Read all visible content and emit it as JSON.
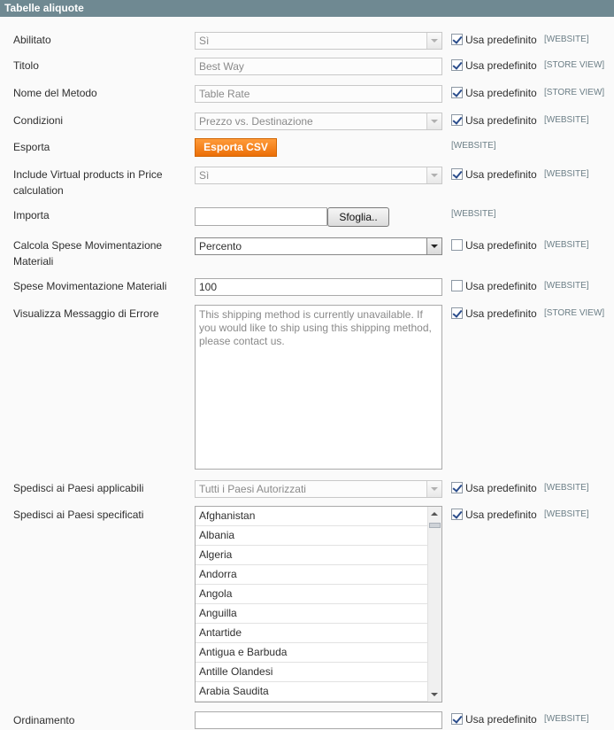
{
  "section": {
    "title": "Tabelle aliquote"
  },
  "defaults": {
    "use_default_label": "Usa predefinito"
  },
  "scopes": {
    "website": "[WEBSITE]",
    "store_view": "[STORE VIEW]"
  },
  "rows": {
    "abilitato": {
      "label": "Abilitato",
      "value": "Sì"
    },
    "titolo": {
      "label": "Titolo",
      "value": "Best Way"
    },
    "nome_metodo": {
      "label": "Nome del Metodo",
      "value": "Table Rate"
    },
    "condizioni": {
      "label": "Condizioni",
      "value": "Prezzo vs. Destinazione"
    },
    "esporta": {
      "label": "Esporta",
      "button": "Esporta CSV"
    },
    "virtual": {
      "label": "Include Virtual products in Price calculation",
      "value": "Sì"
    },
    "importa": {
      "label": "Importa",
      "button": "Sfoglia.."
    },
    "calcola": {
      "label": "Calcola Spese Movimentazione Materiali",
      "value": "Percento"
    },
    "spese": {
      "label": "Spese Movimentazione Materiali",
      "value": "100"
    },
    "messaggio": {
      "label": "Visualizza Messaggio di Errore",
      "value": "This shipping method is currently unavailable. If you would like to ship using this shipping method, please contact us."
    },
    "paesi_applicabili": {
      "label": "Spedisci ai Paesi applicabili",
      "value": "Tutti i Paesi Autorizzati"
    },
    "paesi_specificati": {
      "label": "Spedisci ai Paesi specificati"
    },
    "ordinamento": {
      "label": "Ordinamento",
      "value": ""
    }
  },
  "countries": [
    "Afghanistan",
    "Albania",
    "Algeria",
    "Andorra",
    "Angola",
    "Anguilla",
    "Antartide",
    "Antigua e Barbuda",
    "Antille Olandesi",
    "Arabia Saudita"
  ],
  "colors": {
    "header_bg": "#6f8992",
    "button_orange": "#f07d12",
    "scope_text": "#6b7e86"
  }
}
